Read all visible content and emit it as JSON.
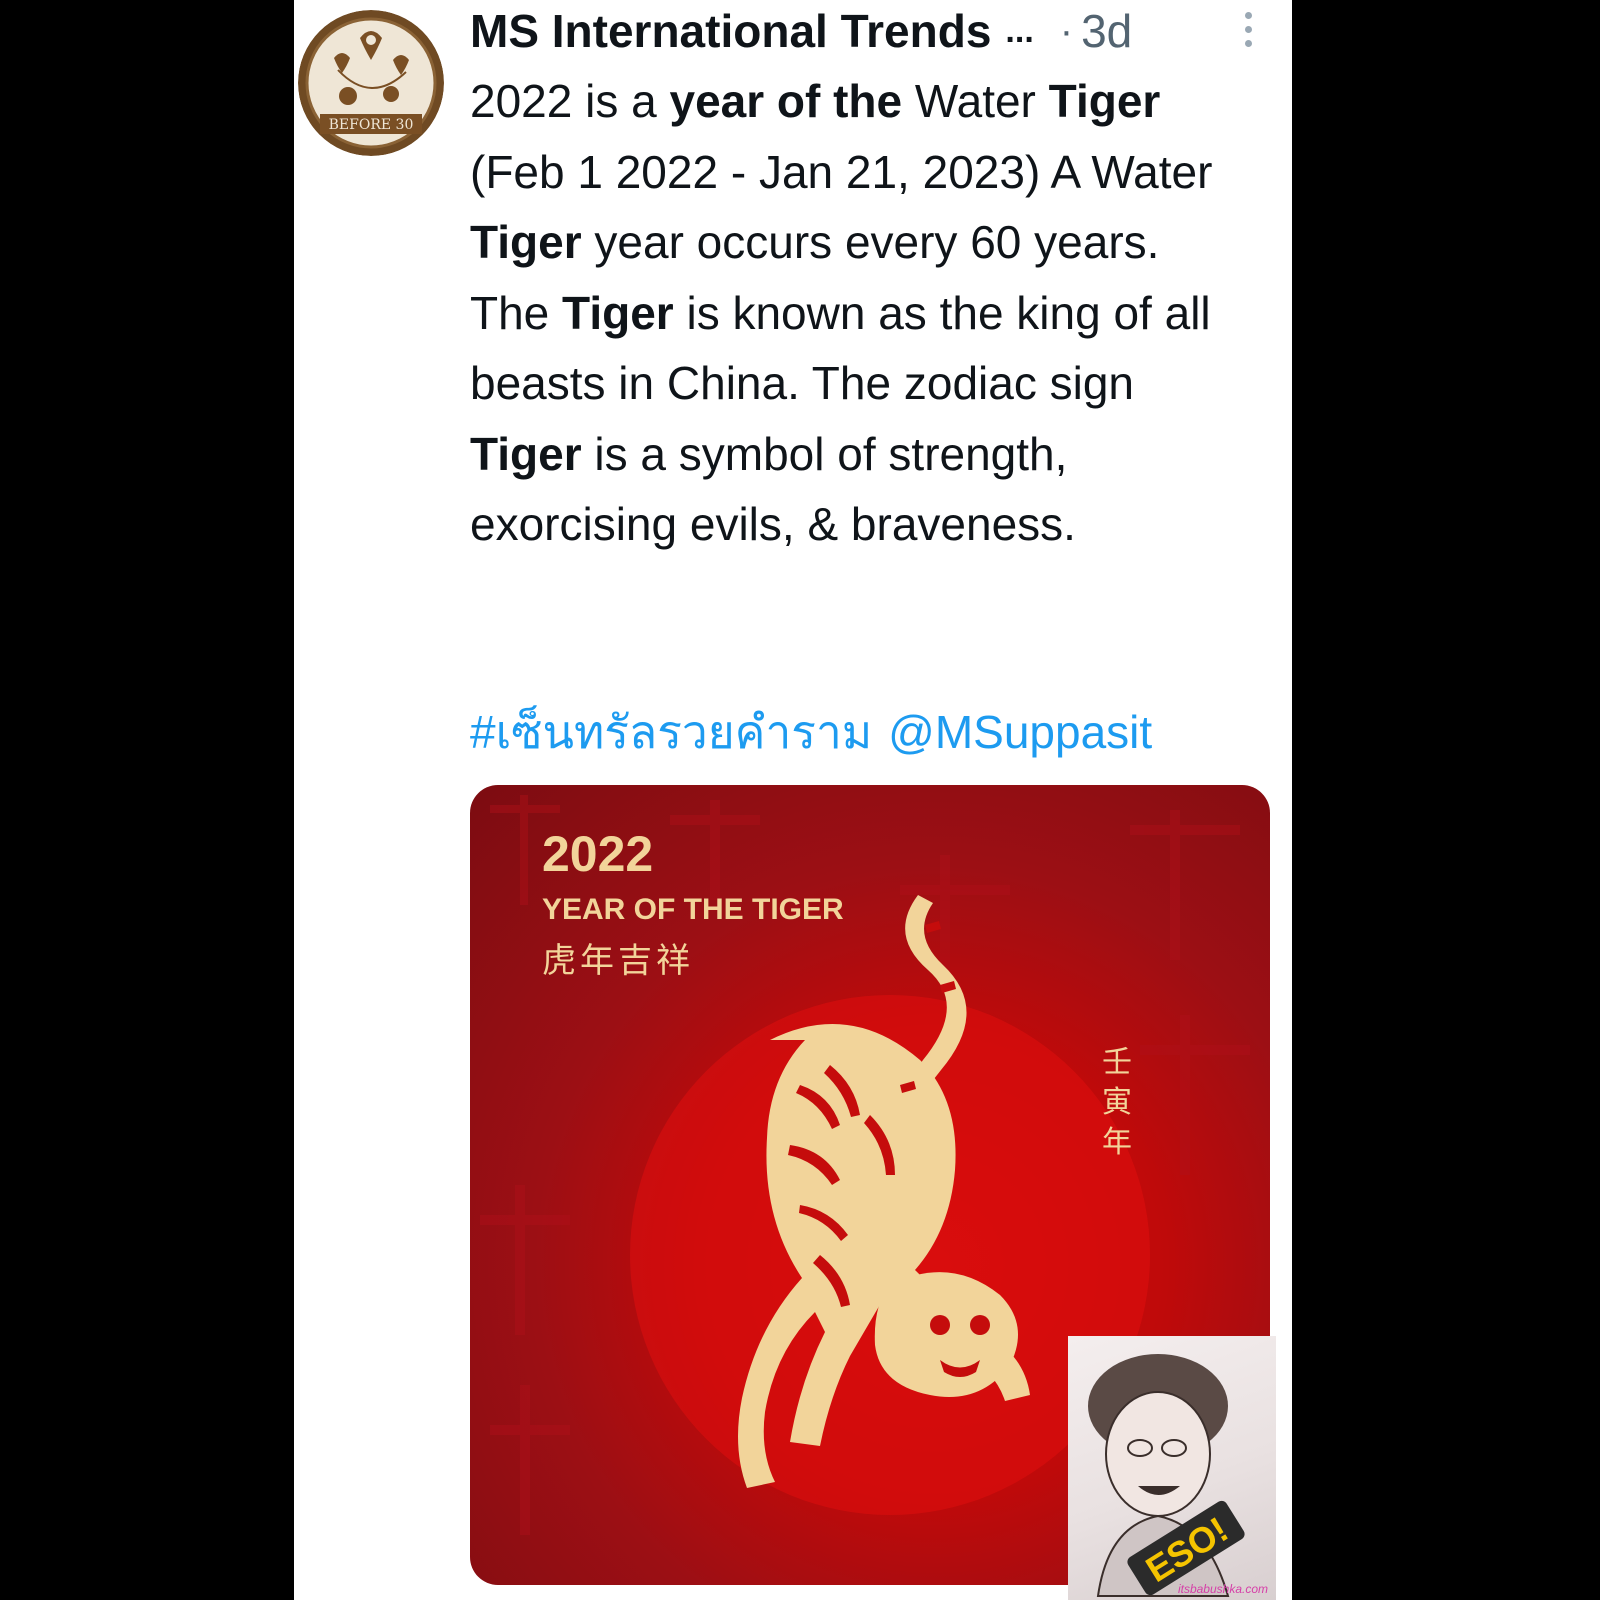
{
  "tweet": {
    "author": "MS International Trends",
    "truncation": "...",
    "separator": "·",
    "age": "3d",
    "avatar_text": "BEFORE 30",
    "body": {
      "s1": "2022 is a ",
      "s2": "year of the",
      "s3": " Water ",
      "s4": "Tiger",
      "s5": " (Feb 1 2022 - Jan 21, 2023) A Water ",
      "s6": "Tiger",
      "s7": " year occurs every 60 years. The ",
      "s8": "Tiger",
      "s9": " is known as the king of all beasts in China. The zodiac sign ",
      "s10": "Tiger",
      "s11": " is a symbol of strength, exorcising evils, & braveness."
    },
    "hashtag": "#เซ็นทรัลรวยคำราม",
    "mention": "@MSuppasit"
  },
  "media": {
    "year": "2022",
    "title": "YEAR OF THE TIGER",
    "chinese_blessing": "虎年吉祥",
    "chinese_vertical": [
      "壬",
      "寅",
      "年"
    ]
  },
  "overlay": {
    "sticker": "ESO!",
    "watermark": "itsbabushka.com"
  },
  "colors": {
    "link": "#1d9bf0",
    "text": "#0f1419",
    "meta": "#536471",
    "poster_red": "#c50c0c",
    "poster_gold": "#f2d49a"
  },
  "icons": [
    "more-options-icon",
    "tiger-illustration"
  ]
}
